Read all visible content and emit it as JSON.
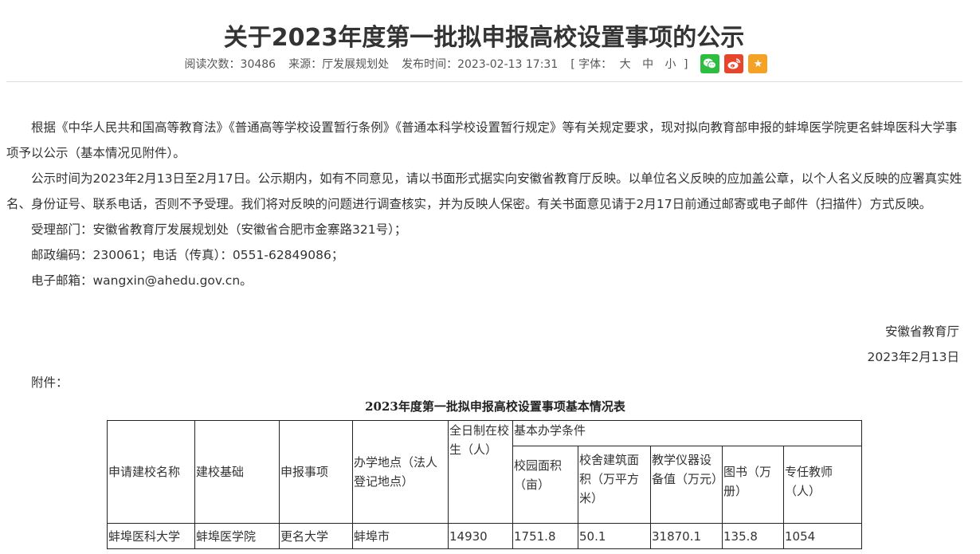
{
  "article": {
    "title": "关于2023年度第一批拟申报高校设置事项的公示",
    "meta": {
      "reads": "阅读次数：30486",
      "source": "来源：厅发展规划处",
      "published": "发布时间：2023-02-13 17:31"
    },
    "font_size": {
      "open": "[ 字体：",
      "large": "大",
      "medium": "中",
      "small": "小",
      "close": "]"
    },
    "share": {
      "wechat_icon": "wechat-icon",
      "weibo_icon": "weibo-icon",
      "favorite_icon": "star-icon",
      "favorite_glyph": "★"
    },
    "paragraphs": [
      "根据《中华人民共和国高等教育法》《普通高等学校设置暂行条例》《普通本科学校设置暂行规定》等有关规定要求，现对拟向教育部申报的蚌埠医学院更名蚌埠医科大学事项予以公示（基本情况见附件）。",
      "公示时间为2023年2月13日至2月17日。公示期内，如有不同意见，请以书面形式据实向安徽省教育厅反映。以单位名义反映的应加盖公章，以个人名义反映的应署真实姓名、身份证号、联系电话，否则不予受理。我们将对反映的问题进行调查核实，并为反映人保密。有关书面意见请于2月17日前通过邮寄或电子邮件（扫描件）方式反映。",
      "受理部门：安徽省教育厅发展规划处（安徽省合肥市金寨路321号）；",
      "邮政编码：230061；电话（传真）：0551-62849086；",
      "电子邮箱：wangxin@ahedu.gov.cn。"
    ],
    "signature": {
      "org": "安徽省教育厅",
      "date": "2023年2月13日"
    },
    "attachment_label": "附件："
  },
  "table": {
    "title": "2023年度第一批拟申报高校设置事项基本情况表",
    "headers": {
      "school_name": "申请建校名称",
      "base": "建校基础",
      "item": "申报事项",
      "location": "办学地点（法人登记地点）",
      "students": "全日制在校生（人）",
      "conditions": "基本办学条件",
      "campus_area": "校园面积（亩）",
      "building_area": "校舍建筑面积（万平方米）",
      "equipment": "教学仪器设备值（万元）",
      "books": "图书（万册）",
      "teachers": "专任教师（人）"
    },
    "rows": [
      {
        "school_name": "蚌埠医科大学",
        "base": "蚌埠医学院",
        "item": "更名大学",
        "location": "蚌埠市",
        "students": "14930",
        "campus_area": "1751.8",
        "building_area": "50.1",
        "equipment": "31870.1",
        "books": "135.8",
        "teachers": "1054"
      }
    ]
  },
  "colors": {
    "wechat": "#2dbe3f",
    "weibo": "#e8462c",
    "favorite": "#f3a225",
    "text": "#333333",
    "divider": "#dddddd"
  }
}
